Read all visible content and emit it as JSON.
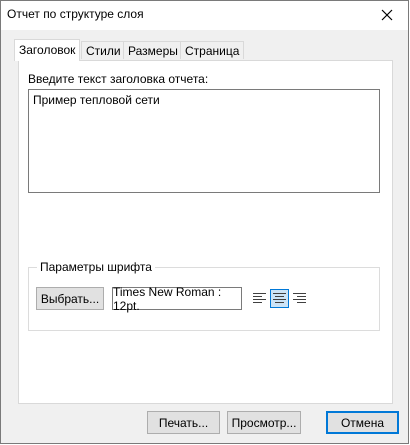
{
  "window": {
    "title": "Отчет по структуре слоя"
  },
  "tabs": [
    {
      "label": "Заголовок",
      "active": true
    },
    {
      "label": "Стили",
      "active": false
    },
    {
      "label": "Размеры",
      "active": false
    },
    {
      "label": "Страница",
      "active": false
    }
  ],
  "header_tab": {
    "prompt_label": "Введите текст заголовка отчета:",
    "title_text": "Пример тепловой сети",
    "font_group": {
      "legend": "Параметры шрифта",
      "choose_button": "Выбрать...",
      "font_value": "Times New Roman : 12pt.",
      "alignment": {
        "options": [
          "align-left-icon",
          "align-center-icon",
          "align-right-icon"
        ],
        "selected": "align-center-icon"
      }
    }
  },
  "footer": {
    "print_button": "Печать...",
    "preview_button": "Просмотр...",
    "cancel_button": "Отмена"
  },
  "colors": {
    "accent": "#0078d7",
    "button_face": "#e1e1e1",
    "dialog_bg": "#f0f0f0"
  }
}
